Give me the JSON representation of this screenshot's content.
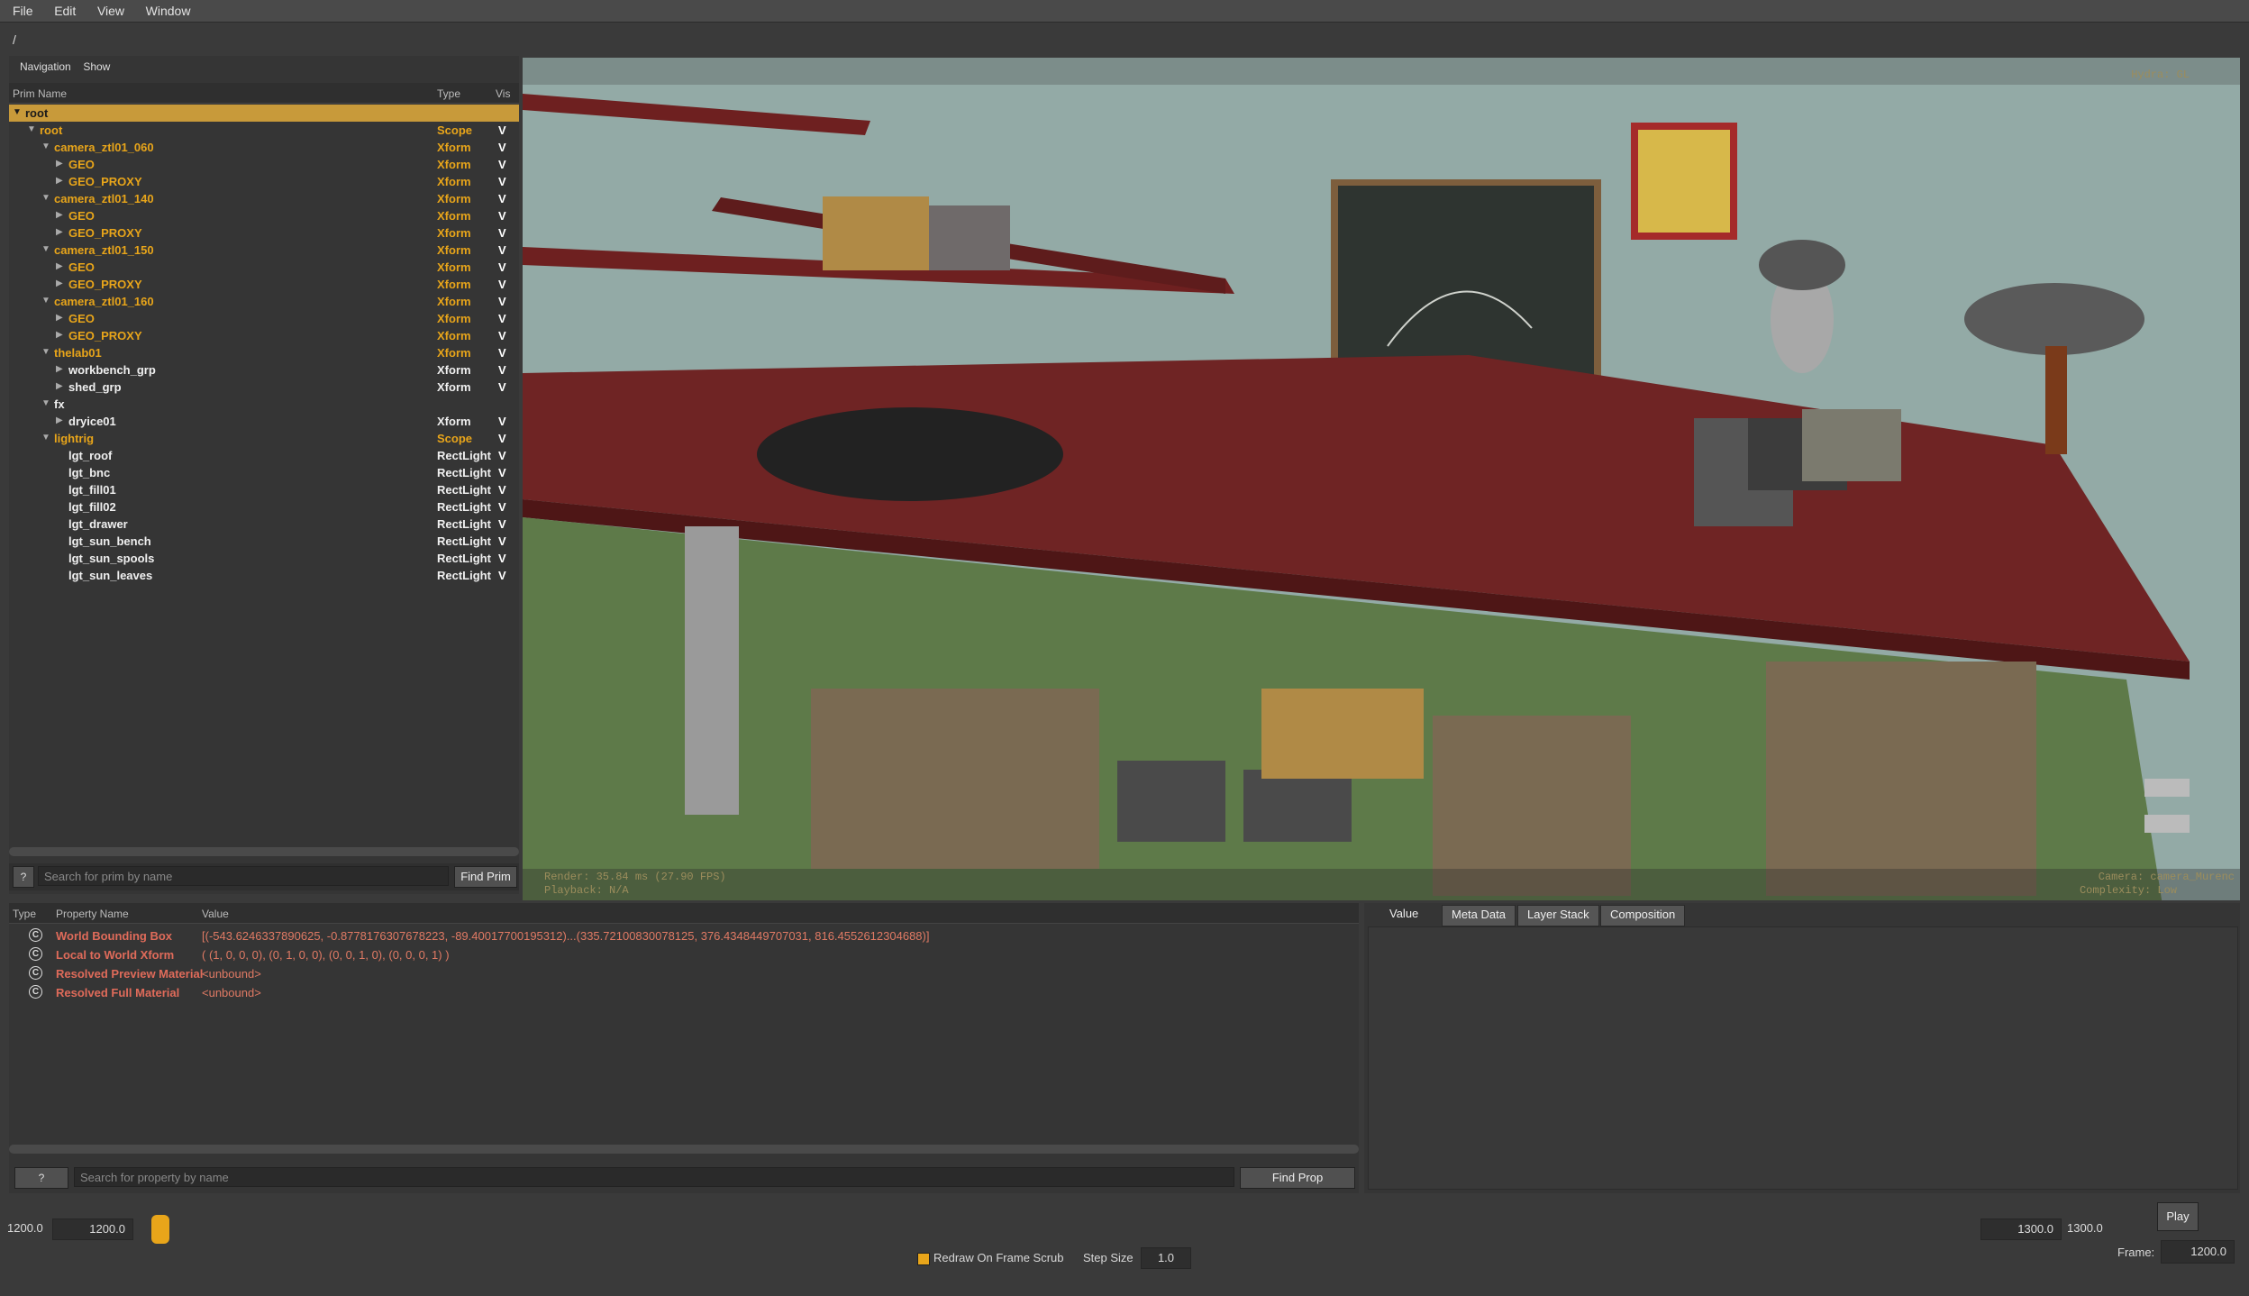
{
  "menu": [
    "File",
    "Edit",
    "View",
    "Window"
  ],
  "path": "/",
  "prim_panel": {
    "tabs": [
      "Navigation",
      "Show"
    ],
    "columns": [
      "Prim Name",
      "Type",
      "Vis"
    ],
    "rows": [
      {
        "name": "root",
        "type": "",
        "vis": "",
        "indent": 0,
        "arrow": "▼",
        "color": "orange",
        "selected": true
      },
      {
        "name": "root",
        "type": "Scope",
        "vis": "V",
        "indent": 1,
        "arrow": "▼",
        "color": "orange"
      },
      {
        "name": "camera_ztl01_060",
        "type": "Xform",
        "vis": "V",
        "indent": 2,
        "arrow": "▼",
        "color": "orange"
      },
      {
        "name": "GEO",
        "type": "Xform",
        "vis": "V",
        "indent": 3,
        "arrow": "▶",
        "color": "orange"
      },
      {
        "name": "GEO_PROXY",
        "type": "Xform",
        "vis": "V",
        "indent": 3,
        "arrow": "▶",
        "color": "orange"
      },
      {
        "name": "camera_ztl01_140",
        "type": "Xform",
        "vis": "V",
        "indent": 2,
        "arrow": "▼",
        "color": "orange"
      },
      {
        "name": "GEO",
        "type": "Xform",
        "vis": "V",
        "indent": 3,
        "arrow": "▶",
        "color": "orange"
      },
      {
        "name": "GEO_PROXY",
        "type": "Xform",
        "vis": "V",
        "indent": 3,
        "arrow": "▶",
        "color": "orange"
      },
      {
        "name": "camera_ztl01_150",
        "type": "Xform",
        "vis": "V",
        "indent": 2,
        "arrow": "▼",
        "color": "orange"
      },
      {
        "name": "GEO",
        "type": "Xform",
        "vis": "V",
        "indent": 3,
        "arrow": "▶",
        "color": "orange"
      },
      {
        "name": "GEO_PROXY",
        "type": "Xform",
        "vis": "V",
        "indent": 3,
        "arrow": "▶",
        "color": "orange"
      },
      {
        "name": "camera_ztl01_160",
        "type": "Xform",
        "vis": "V",
        "indent": 2,
        "arrow": "▼",
        "color": "orange"
      },
      {
        "name": "GEO",
        "type": "Xform",
        "vis": "V",
        "indent": 3,
        "arrow": "▶",
        "color": "orange"
      },
      {
        "name": "GEO_PROXY",
        "type": "Xform",
        "vis": "V",
        "indent": 3,
        "arrow": "▶",
        "color": "orange"
      },
      {
        "name": "thelab01",
        "type": "Xform",
        "vis": "V",
        "indent": 2,
        "arrow": "▼",
        "color": "orange"
      },
      {
        "name": "workbench_grp",
        "type": "Xform",
        "vis": "V",
        "indent": 3,
        "arrow": "▶",
        "color": "white"
      },
      {
        "name": "shed_grp",
        "type": "Xform",
        "vis": "V",
        "indent": 3,
        "arrow": "▶",
        "color": "white"
      },
      {
        "name": "fx",
        "type": "",
        "vis": "",
        "indent": 2,
        "arrow": "▼",
        "color": "white"
      },
      {
        "name": "dryice01",
        "type": "Xform",
        "vis": "V",
        "indent": 3,
        "arrow": "▶",
        "color": "white"
      },
      {
        "name": "lightrig",
        "type": "Scope",
        "vis": "V",
        "indent": 2,
        "arrow": "▼",
        "color": "orange"
      },
      {
        "name": "lgt_roof",
        "type": "RectLight",
        "vis": "V",
        "indent": 3,
        "arrow": "",
        "color": "white"
      },
      {
        "name": "lgt_bnc",
        "type": "RectLight",
        "vis": "V",
        "indent": 3,
        "arrow": "",
        "color": "white"
      },
      {
        "name": "lgt_fill01",
        "type": "RectLight",
        "vis": "V",
        "indent": 3,
        "arrow": "",
        "color": "white"
      },
      {
        "name": "lgt_fill02",
        "type": "RectLight",
        "vis": "V",
        "indent": 3,
        "arrow": "",
        "color": "white"
      },
      {
        "name": "lgt_drawer",
        "type": "RectLight",
        "vis": "V",
        "indent": 3,
        "arrow": "",
        "color": "white"
      },
      {
        "name": "lgt_sun_bench",
        "type": "RectLight",
        "vis": "V",
        "indent": 3,
        "arrow": "",
        "color": "white"
      },
      {
        "name": "lgt_sun_spools",
        "type": "RectLight",
        "vis": "V",
        "indent": 3,
        "arrow": "",
        "color": "white"
      },
      {
        "name": "lgt_sun_leaves",
        "type": "RectLight",
        "vis": "V",
        "indent": 3,
        "arrow": "",
        "color": "white"
      }
    ],
    "help_label": "?",
    "search_placeholder": "Search for prim by name",
    "find_button": "Find Prim"
  },
  "viewport": {
    "renderer": "Hydra: GL",
    "render_stats": "Render: 35.84 ms (27.90 FPS)",
    "playback": "Playback: N/A",
    "camera": "Camera: camera_Murenc",
    "complexity": "Complexity: Low"
  },
  "prop_panel": {
    "columns": [
      "Type",
      "Property Name",
      "Value"
    ],
    "rows": [
      {
        "icon": "C",
        "name": "World Bounding Box",
        "value": "[(-543.6246337890625, -0.8778176307678223, -89.40017700195312)...(335.72100830078125, 376.4348449707031, 816.4552612304688)]"
      },
      {
        "icon": "C",
        "name": "Local to World Xform",
        "value": "( (1, 0, 0, 0), (0, 1, 0, 0), (0, 0, 1, 0), (0, 0, 0, 1) )"
      },
      {
        "icon": "C",
        "name": "Resolved Preview Material",
        "value": "<unbound>"
      },
      {
        "icon": "C",
        "name": "Resolved Full Material",
        "value": "<unbound>"
      }
    ],
    "help_label": "?",
    "search_placeholder": "Search for property by name",
    "find_button": "Find Prop"
  },
  "info_panel": {
    "tabs": [
      "Value",
      "Meta Data",
      "Layer Stack",
      "Composition"
    ]
  },
  "timeline": {
    "start_a": "1200.0",
    "start_b": "1200.0",
    "end_a": "1300.0",
    "end_b": "1300.0",
    "play": "Play",
    "redraw_label": "Redraw On Frame Scrub",
    "step_label": "Step Size",
    "step_value": "1.0",
    "frame_label": "Frame:",
    "frame_value": "1200.0",
    "slider_fraction": 0.0
  },
  "colors": {
    "accent": "#e8a51a",
    "selected_row": "#c89a3a",
    "property_text": "#e06b5a"
  }
}
